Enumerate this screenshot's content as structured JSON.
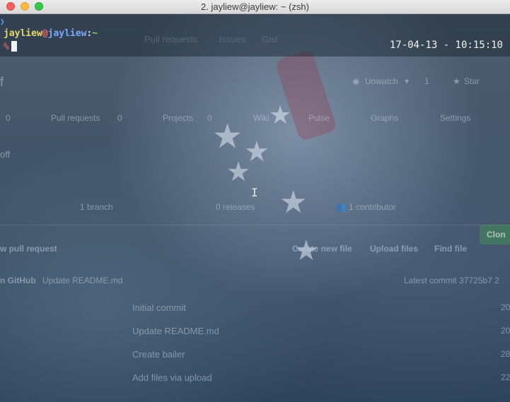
{
  "window": {
    "title": "2. jayliew@jayliew: ~ (zsh)"
  },
  "terminal": {
    "prompt_marker": "❯",
    "user": "jayliew",
    "at": "@",
    "host": "jayliew",
    "separator": ":",
    "directory": "~",
    "input_symbol": "%",
    "clock": "17-04-13 - 10:15:10"
  },
  "background_page": {
    "nav": [
      "Pull requests",
      "Issues",
      "Gist"
    ],
    "repo_fragment": "f",
    "unwatch_label": "Unwatch",
    "watch_count": "1",
    "star_label": "Star",
    "tabs": [
      {
        "label": "Pull requests",
        "count": "0"
      },
      {
        "label": "Projects",
        "count": "0"
      },
      {
        "label": "Wiki"
      },
      {
        "label": "Pulse"
      },
      {
        "label": "Graphs"
      },
      {
        "label": "Settings"
      }
    ],
    "left_count": "0",
    "left_fragment": "off",
    "stats": {
      "branch": "1 branch",
      "releases": "0 releases",
      "contributor": "1 contributor"
    },
    "actions": {
      "new_pull_request": "w pull request",
      "create_new_file": "Create new file",
      "upload_files": "Upload files",
      "find_file": "Find file",
      "clone": "Clon"
    },
    "commit_bar": {
      "author": "n GitHub",
      "message": "Update README.md",
      "latest": "Latest commit 37725b7 2"
    },
    "files": [
      {
        "message": "Initial commit",
        "age": "20"
      },
      {
        "message": "Update README.md",
        "age": "20"
      },
      {
        "message": "Create bailer",
        "age": "28"
      },
      {
        "message": "Add files via upload",
        "age": "22"
      }
    ]
  },
  "colors": {
    "user": "#e6d96a",
    "host": "#7aa7ff",
    "directory": "#8fd16f",
    "percent": "#e06c75"
  }
}
